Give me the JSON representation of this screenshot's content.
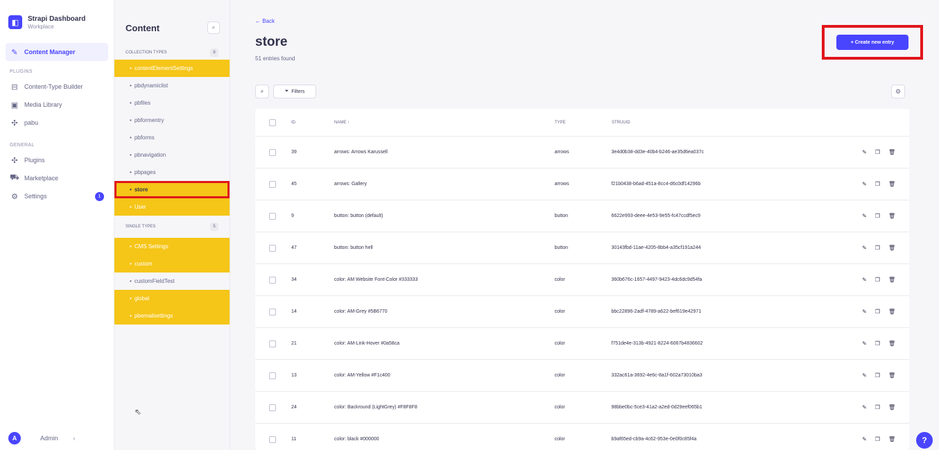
{
  "brand": {
    "title": "Strapi Dashboard",
    "subtitle": "Workplace"
  },
  "nav": {
    "content_manager": "Content Manager",
    "plugins_heading": "PLUGINS",
    "content_type_builder": "Content-Type Builder",
    "media_library": "Media Library",
    "pabu": "pabu",
    "general_heading": "GENERAL",
    "plugins": "Plugins",
    "marketplace": "Marketplace",
    "settings": "Settings",
    "settings_badge": "1",
    "admin_initial": "A",
    "admin_name": "Admin"
  },
  "content_sidebar": {
    "title": "Content",
    "collection_types_label": "COLLECTION TYPES",
    "collection_types_count": "8",
    "collection_types": [
      "contentElementSettings",
      "pbdynamiclist",
      "pbfiles",
      "pbformentry",
      "pbforms",
      "pbnavigation",
      "pbpages",
      "store",
      "User"
    ],
    "single_types_label": "SINGLE TYPES",
    "single_types_count": "5",
    "single_types": [
      "CMS Settings",
      "custom",
      "customFieldTest",
      "global",
      "pbemailsettings"
    ]
  },
  "main": {
    "back": "Back",
    "title": "store",
    "entries_found": "51 entries found",
    "create_button": "+ Create new entry",
    "filters_button": "Filters"
  },
  "table": {
    "headers": {
      "id": "ID",
      "name": "NAME",
      "type": "TYPE",
      "uuid": "STRUUID"
    },
    "rows": [
      {
        "id": "39",
        "name": "arrows: Arrows Karussell",
        "type": "arrows",
        "uuid": "3e4d0b38-dd3e-40b4-b246-ae35d6ea037c"
      },
      {
        "id": "45",
        "name": "arrows: Gallery",
        "type": "arrows",
        "uuid": "f21b0438-b6ad-451a-8cc4-d6c0df14296b"
      },
      {
        "id": "9",
        "name": "button: button (default)",
        "type": "button",
        "uuid": "6622e993-deee-4e53-9e55-fc47ccdf5ec9"
      },
      {
        "id": "47",
        "name": "button: button hell",
        "type": "button",
        "uuid": "30143fbd-11ae-4205-8bb4-a35cf191a244"
      },
      {
        "id": "34",
        "name": "color: AM Website Font-Color #333333",
        "type": "color",
        "uuid": "360b676c-1657-4497-9423-4dc6dc9d54fa"
      },
      {
        "id": "14",
        "name": "color: AM-Grey #5B6770",
        "type": "color",
        "uuid": "bbc22896-2adf-4789-a622-bef619e42971"
      },
      {
        "id": "21",
        "name": "color: AM-Link-Hover #0a58ca",
        "type": "color",
        "uuid": "f751de4e-313b-4921-8224-6067b4836602"
      },
      {
        "id": "13",
        "name": "color: AM-Yellow #F1c400",
        "type": "color",
        "uuid": "332ac61a-3692-4e6c-8a1f-602a73010ba3"
      },
      {
        "id": "24",
        "name": "color: Backround (LightGrey) #F8F8F8",
        "type": "color",
        "uuid": "98bbe0bc-5ce3-41a2-a2ed-0d29eef065b1"
      },
      {
        "id": "11",
        "name": "color: black #000000",
        "type": "color",
        "uuid": "b9af65ed-cb9a-4c62-953e-0e0f0c85f4a"
      }
    ]
  },
  "help": "?"
}
